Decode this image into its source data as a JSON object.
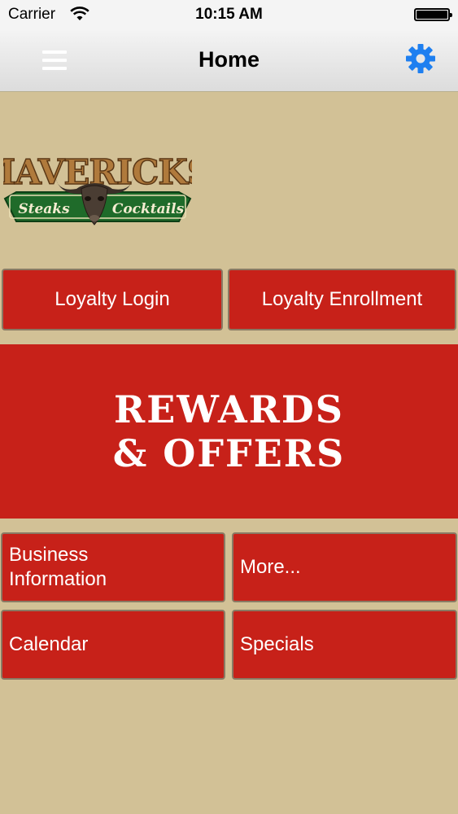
{
  "status_bar": {
    "carrier": "Carrier",
    "time": "10:15 AM"
  },
  "nav": {
    "title": "Home",
    "menu_icon": "menu-icon",
    "settings_icon": "gear-icon",
    "gear_color": "#1e7ff0"
  },
  "logo": {
    "brand": "MAVERICKS",
    "left_word": "Steaks",
    "right_word": "Cocktails"
  },
  "buttons": {
    "loyalty_login": "Loyalty Login",
    "loyalty_enrollment": "Loyalty Enrollment",
    "business_information": "Business Information",
    "more": "More...",
    "calendar": "Calendar",
    "specials": "Specials"
  },
  "banner": {
    "line1": "REWARDS",
    "line2": "& OFFERS"
  },
  "colors": {
    "background": "#d2c196",
    "button_red": "#c72119",
    "logo_green": "#1f6b2a"
  }
}
